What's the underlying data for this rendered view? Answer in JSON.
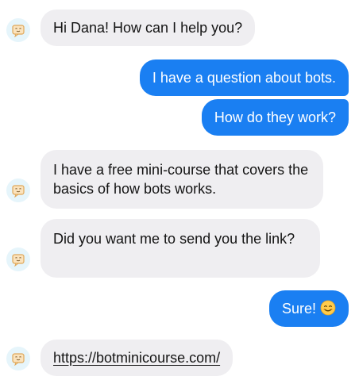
{
  "colors": {
    "bot_bubble": "#efeef1",
    "user_bubble": "#1a7ff2",
    "avatar_bg": "#e6f5fb",
    "avatar_icon": "#f3c98b"
  },
  "messages": [
    {
      "sender": "bot",
      "text": "Hi Dana! How can I help you?"
    },
    {
      "sender": "user",
      "text": "I have a question about bots."
    },
    {
      "sender": "user",
      "text": "How do they work?"
    },
    {
      "sender": "bot",
      "text": "I have a free mini-course that covers the basics of how bots works."
    },
    {
      "sender": "bot",
      "text": "Did you want me to send you the link?"
    },
    {
      "sender": "user",
      "text": "Sure!",
      "emoji": "smiling-face-emoji"
    },
    {
      "sender": "bot",
      "text": "https://botminicourse.com/",
      "is_link": true
    }
  ],
  "bot_avatar_icon": "bot-face-icon"
}
